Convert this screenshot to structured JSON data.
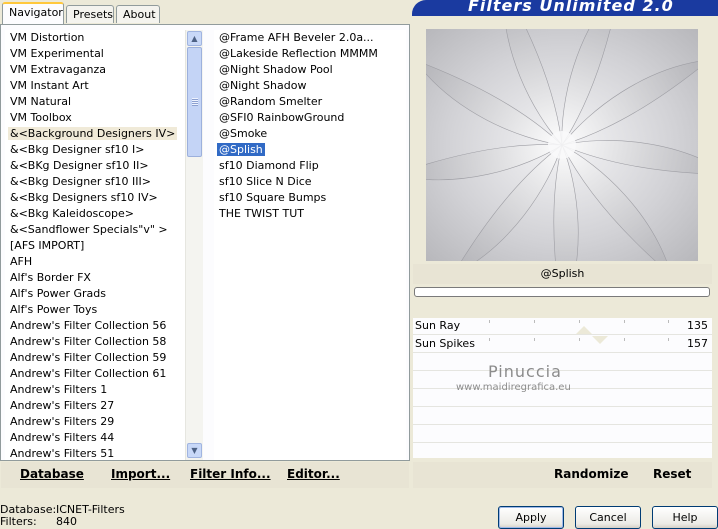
{
  "tabs": [
    {
      "label": "Navigator",
      "active": true
    },
    {
      "label": "Presets",
      "active": false
    },
    {
      "label": "About",
      "active": false
    }
  ],
  "banner": {
    "title": "Filters Unlimited 2.0"
  },
  "categories": {
    "items": [
      "VM Distortion",
      "VM Experimental",
      "VM Extravaganza",
      "VM Instant Art",
      "VM Natural",
      "VM Toolbox",
      "&<Background Designers IV>",
      "&<Bkg Designer sf10 I>",
      "&<BKg Designer sf10 II>",
      "&<Bkg Designer sf10 III>",
      "&<Bkg Designers sf10 IV>",
      "&<Bkg Kaleidoscope>",
      "&<Sandflower Specials\"v\" >",
      "[AFS IMPORT]",
      "AFH",
      "Alf's Border FX",
      "Alf's Power Grads",
      "Alf's Power Toys",
      "Andrew's Filter Collection 56",
      "Andrew's Filter Collection 58",
      "Andrew's Filter Collection 59",
      "Andrew's Filter Collection 61",
      "Andrew's Filters 1",
      "Andrew's Filters 27",
      "Andrew's Filters 29",
      "Andrew's Filters 44",
      "Andrew's Filters 51"
    ],
    "highlighted_index": 6
  },
  "filters": {
    "items": [
      "@Frame AFH Beveler 2.0a...",
      "@Lakeside Reflection MMMM",
      "@Night Shadow Pool",
      "@Night Shadow",
      "@Random Smelter",
      "@SFI0 RainbowGround",
      "@Smoke",
      "@Splish",
      "sf10 Diamond Flip",
      "sf10 Slice N Dice",
      "sf10 Square Bumps",
      "THE TWIST TUT"
    ],
    "selected_index": 7
  },
  "toolbar": {
    "database": "Database",
    "import": "Import...",
    "filter_info": "Filter Info...",
    "editor": "Editor..."
  },
  "preview": {
    "filter_name": "@Splish"
  },
  "params": [
    {
      "label": "Sun Ray",
      "value": "135",
      "level": 135
    },
    {
      "label": "Sun Spikes",
      "value": "157",
      "level": 157
    }
  ],
  "right_toolbar": {
    "randomize": "Randomize",
    "reset": "Reset"
  },
  "watermark": {
    "name": "Pinuccia",
    "site": "www.maidiregrafica.eu"
  },
  "status": {
    "database_label": "Database:",
    "database_value": "ICNET-Filters",
    "filters_label": "Filters:",
    "filters_value": "840"
  },
  "buttons": {
    "apply": "Apply",
    "cancel": "Cancel",
    "help": "Help"
  }
}
